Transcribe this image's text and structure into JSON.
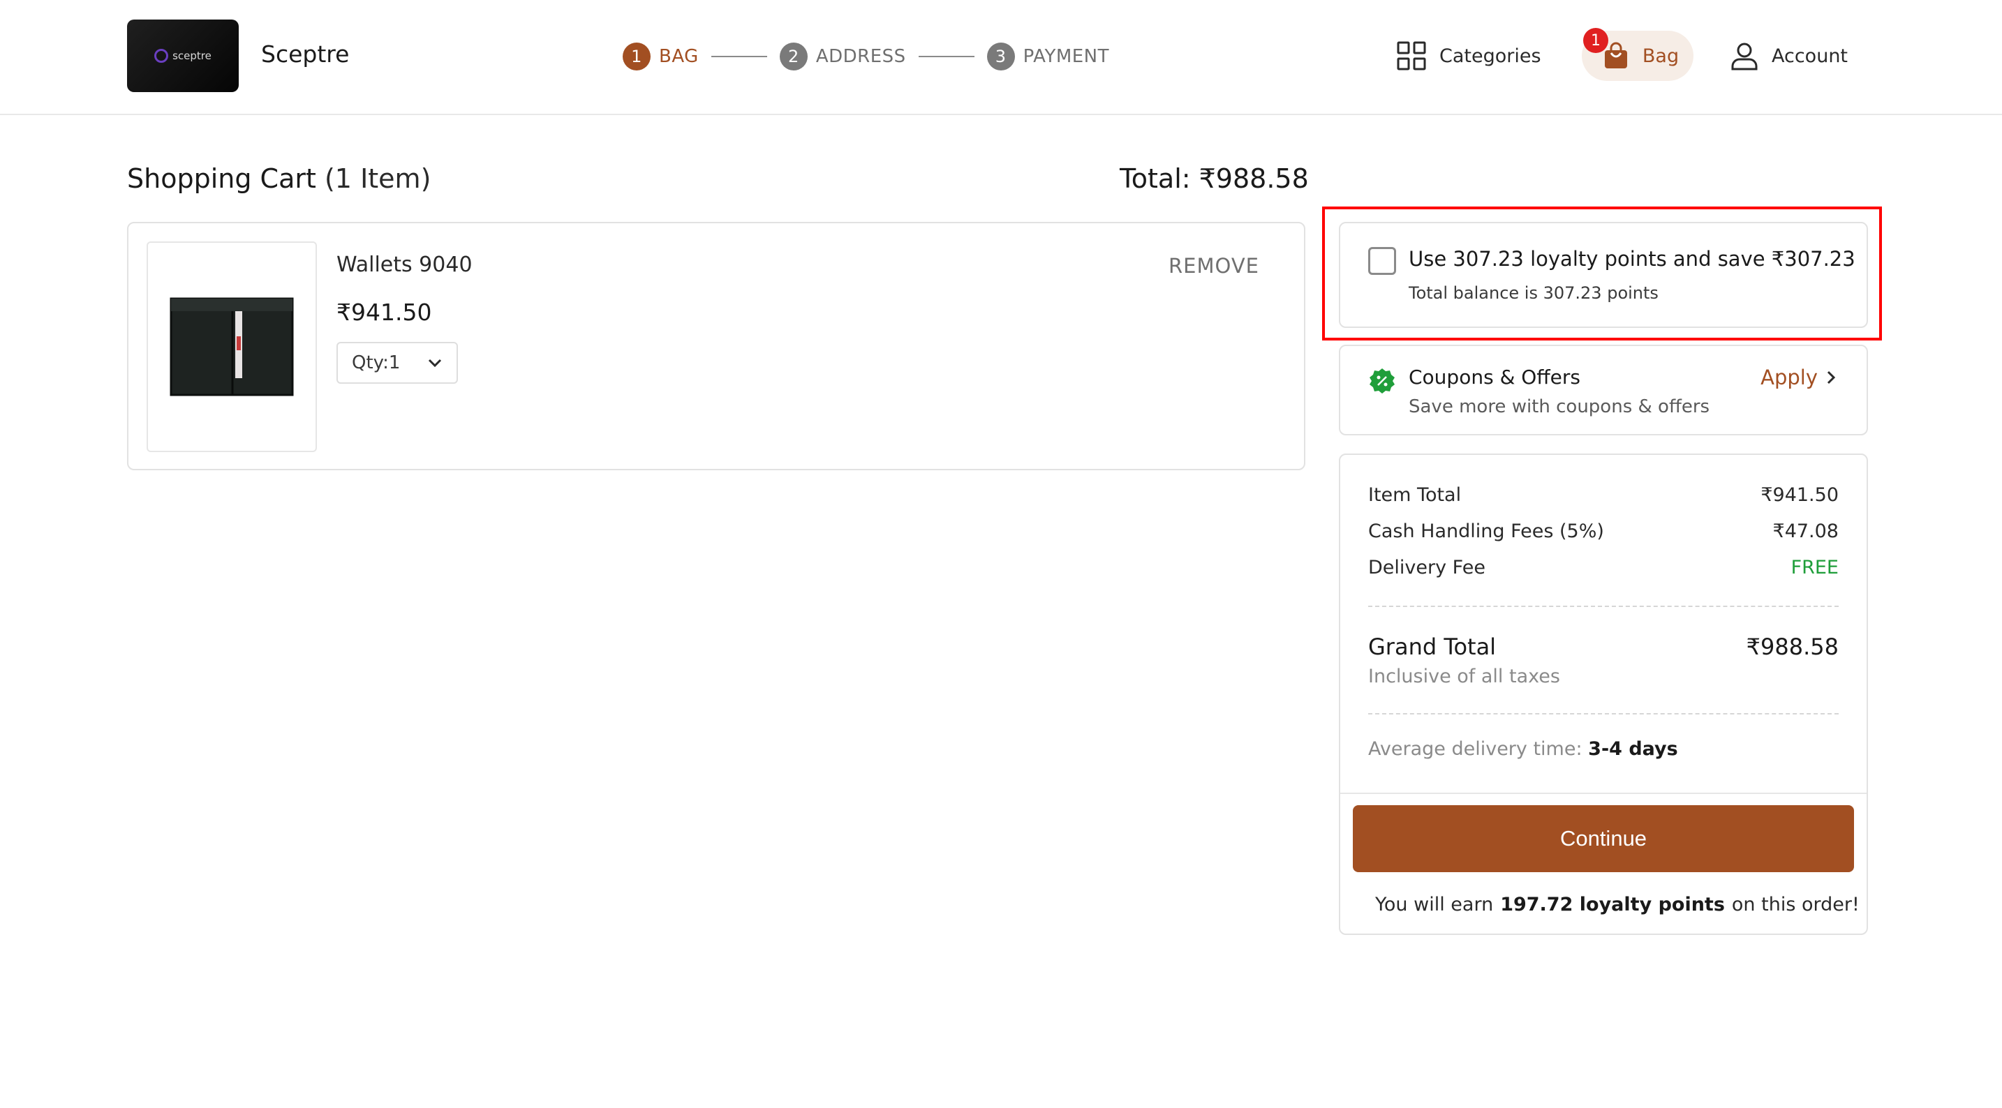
{
  "header": {
    "brand_name": "Sceptre",
    "logo_text": "sceptre",
    "steps": [
      {
        "num": "1",
        "label": "BAG",
        "active": true
      },
      {
        "num": "2",
        "label": "ADDRESS",
        "active": false
      },
      {
        "num": "3",
        "label": "PAYMENT",
        "active": false
      }
    ],
    "nav": {
      "categories_label": "Categories",
      "bag_label": "Bag",
      "bag_count": "1",
      "account_label": "Account"
    }
  },
  "cart": {
    "title": "Shopping Cart",
    "item_count": "(1 Item)",
    "total": "Total: ₹988.58",
    "items": [
      {
        "name": "Wallets 9040",
        "price": "₹941.50",
        "qty_label": "Qty:",
        "qty_value": "1",
        "remove_label": "REMOVE"
      }
    ]
  },
  "loyalty": {
    "main_text": "Use 307.23 loyalty points and save ₹307.23",
    "sub_text": "Total balance is 307.23 points",
    "checked": false
  },
  "coupons": {
    "title": "Coupons & Offers",
    "subtitle": "Save more with coupons & offers",
    "apply_label": "Apply"
  },
  "summary": {
    "rows": [
      {
        "label": "Item Total",
        "value": "₹941.50"
      },
      {
        "label": "Cash Handling Fees (5%)",
        "value": "₹47.08"
      },
      {
        "label": "Delivery Fee",
        "value": "FREE"
      }
    ],
    "grand_total_label": "Grand Total",
    "grand_total_value": "₹988.58",
    "grand_total_sub": "Inclusive of all taxes",
    "delivery_prefix": "Average delivery time:",
    "delivery_value": "3-4 days",
    "continue_label": "Continue",
    "earn_prefix": "You will earn",
    "earn_points": "197.72 loyalty points",
    "earn_suffix": "on this order!"
  },
  "colors": {
    "accent": "#a24f22",
    "free_green": "#1f9e3a",
    "badge_red": "#e02020",
    "highlight_red": "#ff0000"
  }
}
